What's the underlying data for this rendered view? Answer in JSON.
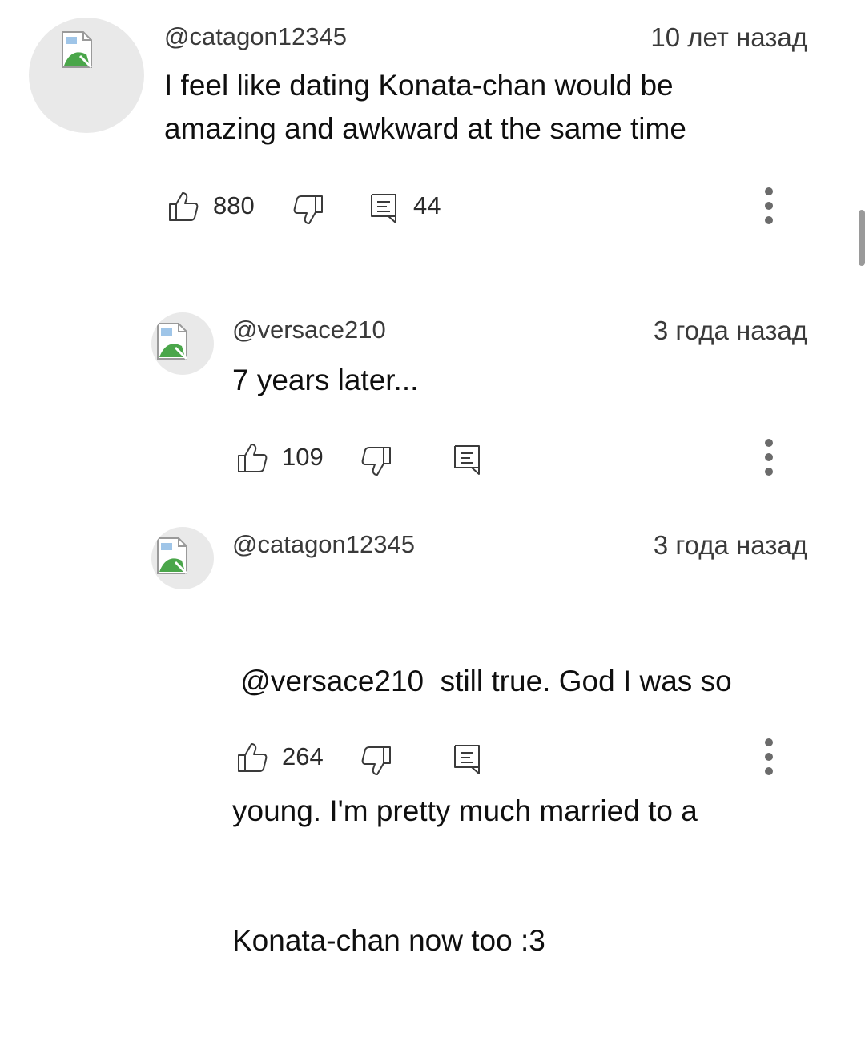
{
  "comments": [
    {
      "author": "@catagon12345",
      "time": "10 лет назад",
      "text_lines": [
        "I feel like dating Konata-chan would be",
        "amazing and awkward at the same time"
      ],
      "likes": "880",
      "replies": "44",
      "avatar_icon": "broken-image-icon"
    },
    {
      "author": "@versace210",
      "time": "3 года назад",
      "text_lines": [
        "7 years later..."
      ],
      "likes": "109",
      "replies": "",
      "avatar_icon": "broken-image-icon"
    },
    {
      "author": "@catagon12345",
      "time": "3 года назад",
      "text_lines": [
        " @versace210  still true. God I was so",
        "young. I'm pretty much married to a",
        "Konata-chan now too :3"
      ],
      "likes": "264",
      "replies": "",
      "avatar_icon": "broken-image-icon"
    }
  ],
  "icons": {
    "like": "thumbs-up-icon",
    "dislike": "thumbs-down-icon",
    "reply": "reply-icon",
    "more": "more-vertical-icon"
  }
}
